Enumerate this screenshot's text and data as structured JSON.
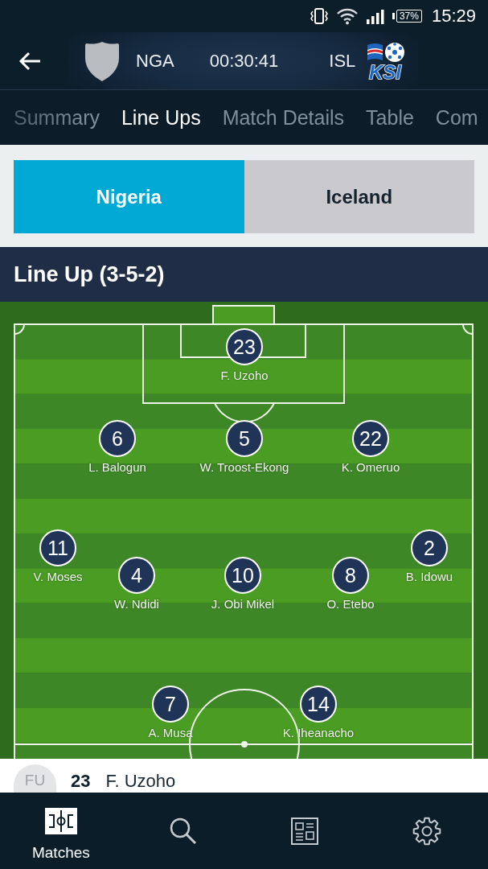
{
  "status_bar": {
    "battery": "37%",
    "time": "15:29"
  },
  "match_header": {
    "home": {
      "code": "NGA"
    },
    "clock": "00:30:41",
    "away": {
      "code": "ISL",
      "logo_text": "KSI"
    }
  },
  "tabs": [
    {
      "label": "Summary",
      "selected": false
    },
    {
      "label": "Line Ups",
      "selected": true
    },
    {
      "label": "Match Details",
      "selected": false
    },
    {
      "label": "Table",
      "selected": false
    },
    {
      "label": "Com",
      "selected": false
    }
  ],
  "team_toggle": [
    {
      "label": "Nigeria",
      "selected": true
    },
    {
      "label": "Iceland",
      "selected": false
    }
  ],
  "lineup": {
    "title": "Line Up (3-5-2)",
    "rows": [
      {
        "players": [
          {
            "number": "23",
            "name": "F. Uzoho"
          }
        ]
      },
      {
        "players": [
          {
            "number": "6",
            "name": "L. Balogun"
          },
          {
            "number": "5",
            "name": "W. Troost-Ekong"
          },
          {
            "number": "22",
            "name": "K. Omeruo"
          }
        ]
      },
      {
        "players": [
          {
            "number": "11",
            "name": "V. Moses"
          },
          {
            "number": "4",
            "name": "W. Ndidi"
          },
          {
            "number": "10",
            "name": "J. Obi Mikel"
          },
          {
            "number": "8",
            "name": "O. Etebo"
          },
          {
            "number": "2",
            "name": "B. Idowu"
          }
        ]
      },
      {
        "players": [
          {
            "number": "7",
            "name": "A. Musa"
          },
          {
            "number": "14",
            "name": "K. Iheanacho"
          }
        ]
      }
    ]
  },
  "squad_list": [
    {
      "initials": "FU",
      "number": "23",
      "name": "F. Uzoho"
    }
  ],
  "bottom_nav": [
    {
      "label": "Matches",
      "selected": true
    },
    {
      "selected": false
    },
    {
      "selected": false
    },
    {
      "selected": false
    }
  ]
}
